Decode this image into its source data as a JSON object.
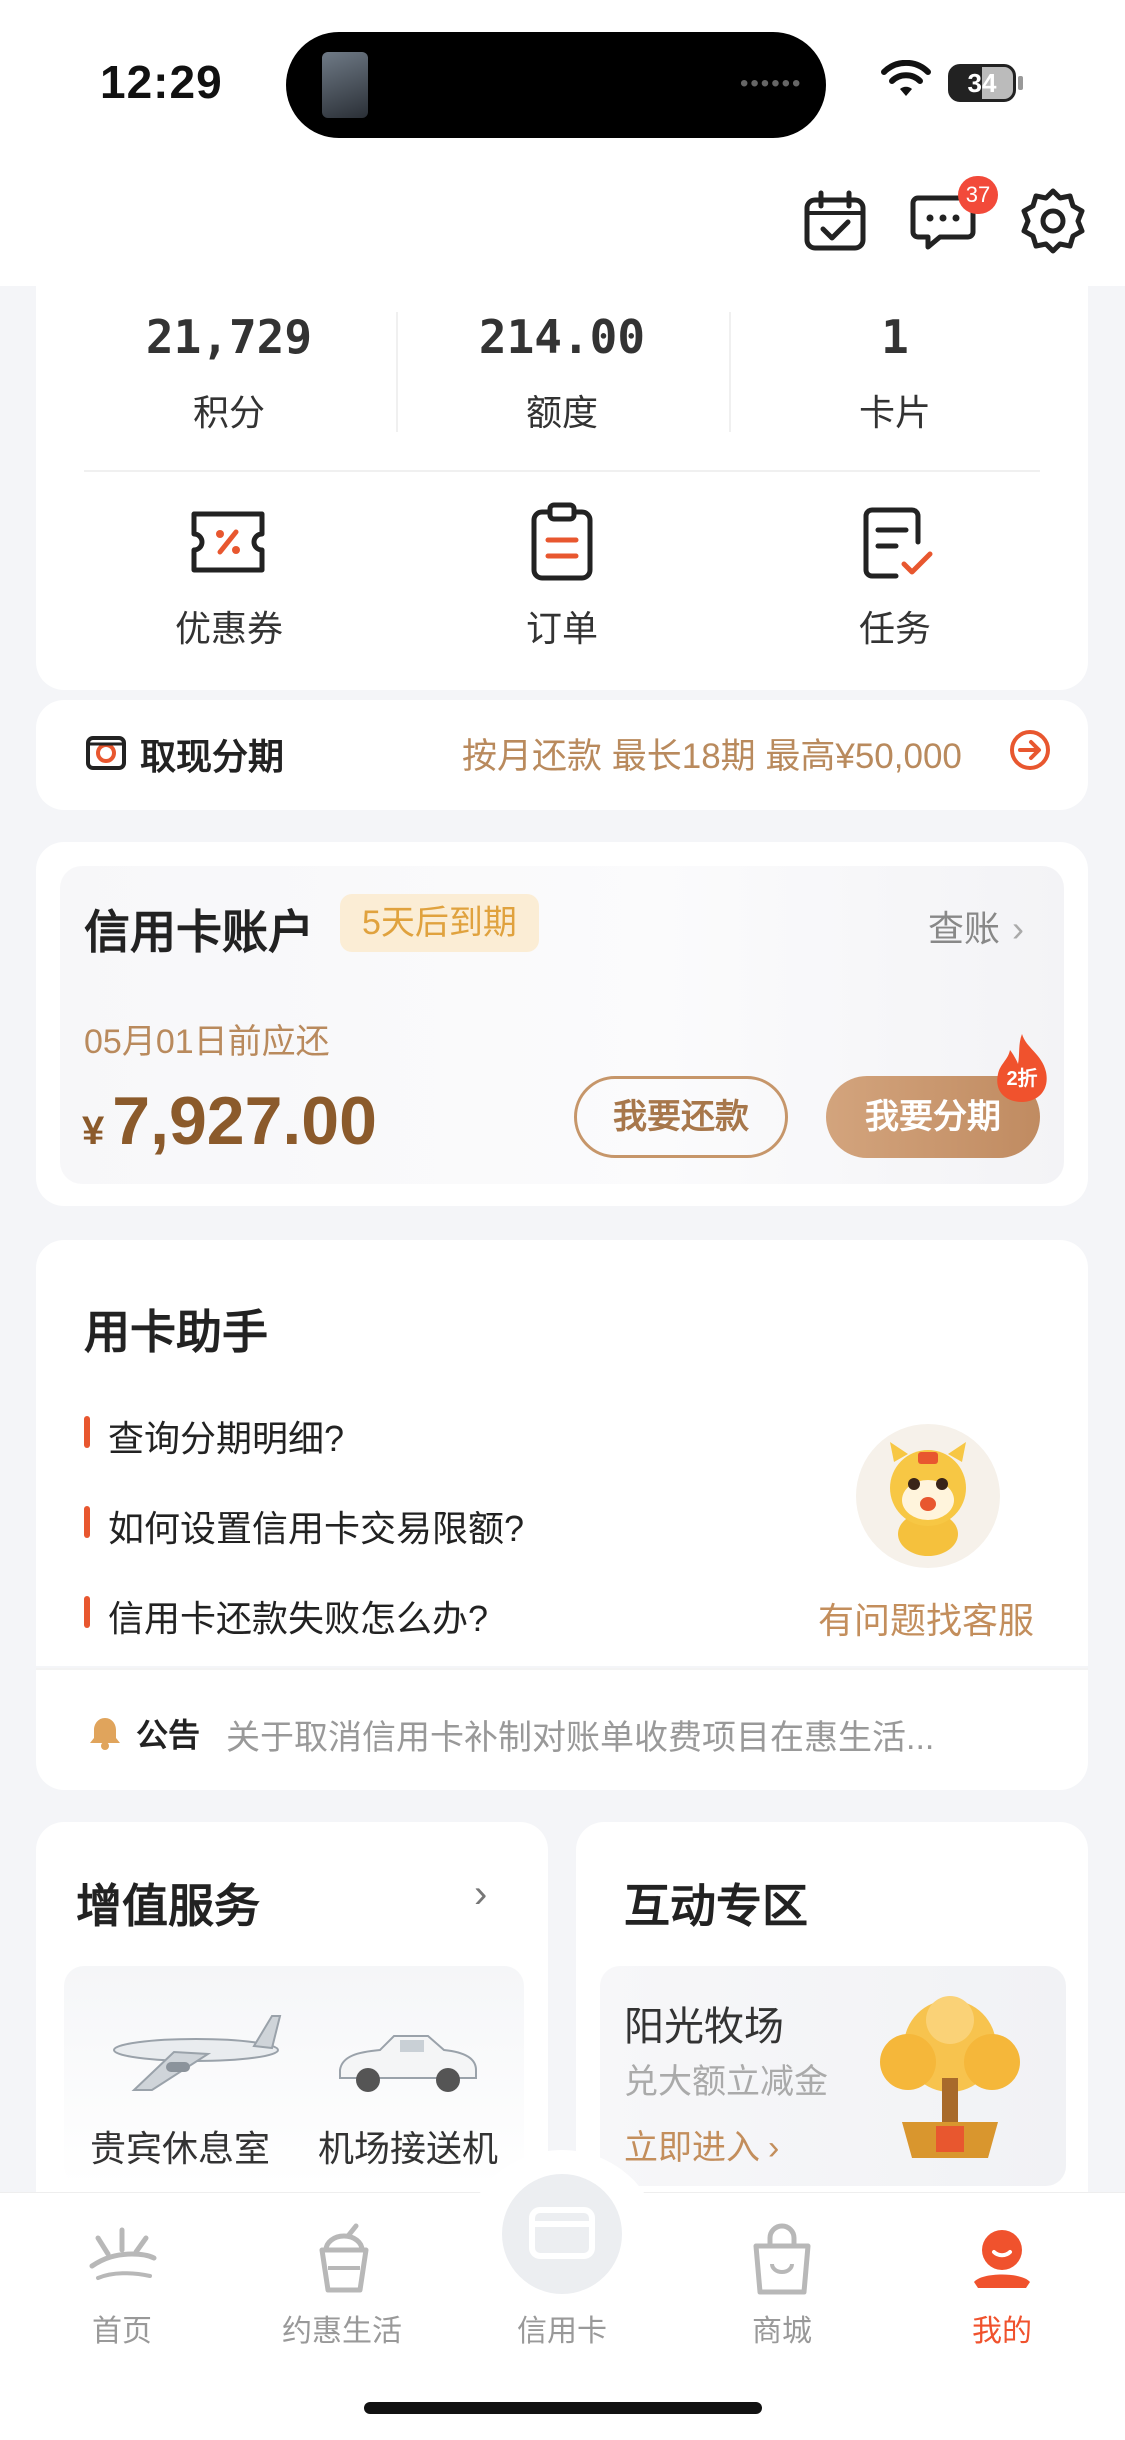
{
  "status_bar": {
    "time": "12:29",
    "battery": "34"
  },
  "header": {
    "messages_badge": "37"
  },
  "stats": [
    {
      "value": "21,729",
      "label": "积分"
    },
    {
      "value": "214.00",
      "label": "额度"
    },
    {
      "value": "1",
      "label": "卡片"
    }
  ],
  "quick_menu": [
    {
      "label": "优惠券",
      "icon": "coupon-icon"
    },
    {
      "label": "订单",
      "icon": "order-icon"
    },
    {
      "label": "任务",
      "icon": "task-icon"
    }
  ],
  "cash_installment": {
    "title": "取现分期",
    "desc": "按月还款 最长18期 最高¥50,000"
  },
  "credit_account": {
    "title": "信用卡账户",
    "tag": "5天后到期",
    "link": "查账",
    "due_text": "05月01日前应还",
    "currency": "¥",
    "amount": "7,927.00",
    "repay_label": "我要还款",
    "install_label": "我要分期",
    "promo_badge": "2折"
  },
  "assistant": {
    "title": "用卡助手",
    "questions": [
      "查询分期明细?",
      "如何设置信用卡交易限额?",
      "信用卡还款失败怎么办?"
    ],
    "cs_link": "有问题找客服"
  },
  "notice": {
    "label": "公告",
    "text": "关于取消信用卡补制对账单收费项目在惠生活..."
  },
  "value_services": {
    "title": "增值服务",
    "items": [
      "贵宾休息室",
      "机场接送机"
    ]
  },
  "interactive": {
    "title": "互动专区",
    "name": "阳光牧场",
    "desc": "兑大额立减金",
    "cta": "立即进入"
  },
  "tabs": [
    {
      "label": "首页",
      "active": false
    },
    {
      "label": "约惠生活",
      "active": false
    },
    {
      "label": "信用卡",
      "active": false
    },
    {
      "label": "商城",
      "active": false
    },
    {
      "label": "我的",
      "active": true
    }
  ],
  "colors": {
    "accent": "#e8572f",
    "gold": "#b98a5d",
    "brown": "#8b5a2b"
  }
}
